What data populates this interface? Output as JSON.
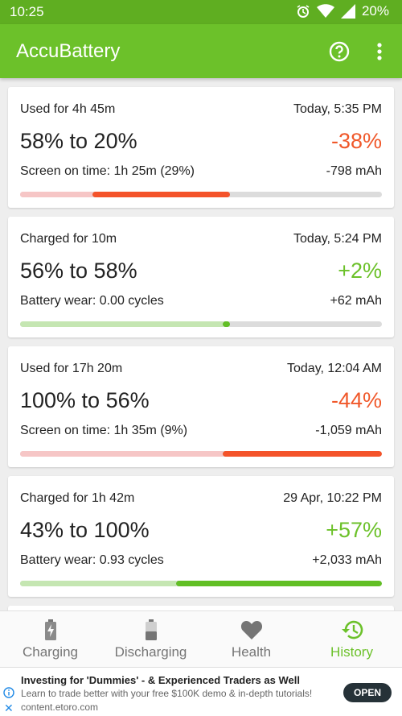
{
  "status_bar": {
    "time": "10:25",
    "battery_text": "20%"
  },
  "app_bar": {
    "title": "AccuBattery",
    "help_icon": "help-circle-icon",
    "menu_icon": "overflow-menu-icon"
  },
  "sessions": [
    {
      "type": "discharge",
      "duration": "Used for 4h 45m",
      "timestamp": "Today, 5:35 PM",
      "range": "58% to 20%",
      "delta": "-38%",
      "detail": "Screen on time: 1h 25m (29%)",
      "mah": "-798 mAh",
      "bar_from": 0.2,
      "bar_to": 0.58
    },
    {
      "type": "charge",
      "duration": "Charged for 10m",
      "timestamp": "Today, 5:24 PM",
      "range": "56% to 58%",
      "delta": "+2%",
      "detail": "Battery wear: 0.00 cycles",
      "mah": "+62 mAh",
      "bar_from": 0.56,
      "bar_to": 0.58
    },
    {
      "type": "discharge",
      "duration": "Used for 17h 20m",
      "timestamp": "Today, 12:04 AM",
      "range": "100% to 56%",
      "delta": "-44%",
      "detail": "Screen on time: 1h 35m (9%)",
      "mah": "-1,059 mAh",
      "bar_from": 0.56,
      "bar_to": 1.0
    },
    {
      "type": "charge",
      "duration": "Charged for 1h 42m",
      "timestamp": "29 Apr, 10:22 PM",
      "range": "43% to 100%",
      "delta": "+57%",
      "detail": "Battery wear: 0.93 cycles",
      "mah": "+2,033 mAh",
      "bar_from": 0.43,
      "bar_to": 1.0
    }
  ],
  "bottom_nav": {
    "tabs": [
      {
        "label": "Charging",
        "icon": "battery-charging-icon",
        "active": false
      },
      {
        "label": "Discharging",
        "icon": "battery-discharging-icon",
        "active": false
      },
      {
        "label": "Health",
        "icon": "heart-icon",
        "active": false
      },
      {
        "label": "History",
        "icon": "history-icon",
        "active": true
      }
    ]
  },
  "ad": {
    "headline": "Investing for 'Dummies' - & Experienced Traders as Well",
    "body": "Learn to trade better with your free $100K demo & in-depth tutorials!",
    "url": "content.etoro.com",
    "cta": "OPEN"
  },
  "colors": {
    "primary": "#6cc12a",
    "status_bar": "#5fae21",
    "discharge": "#f4532a",
    "charge": "#62bf25"
  }
}
